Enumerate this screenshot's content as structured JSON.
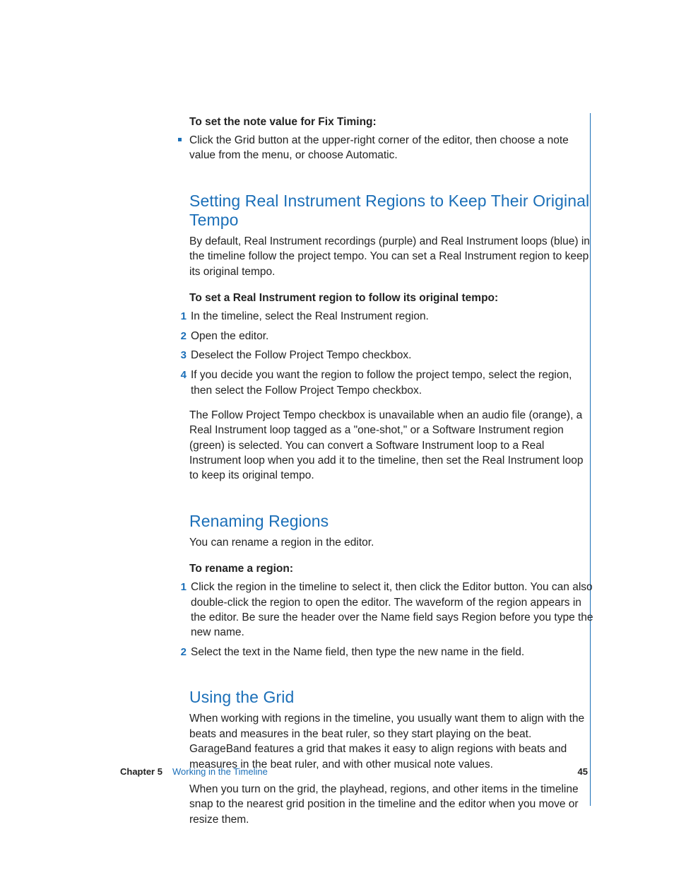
{
  "sec1": {
    "bold": "To set the note value for Fix Timing:",
    "bullet": "Click the Grid button at the upper-right corner of the editor, then choose a note value from the menu, or choose Automatic."
  },
  "sec2": {
    "heading": "Setting Real Instrument Regions to Keep Their Original Tempo",
    "intro": "By default, Real Instrument recordings (purple) and Real Instrument loops (blue) in the timeline follow the project tempo. You can set a Real Instrument region to keep its original tempo.",
    "bold": "To set a Real Instrument region to follow its original tempo:",
    "steps": [
      "In the timeline, select the Real Instrument region.",
      "Open the editor.",
      "Deselect the Follow Project Tempo checkbox.",
      "If you decide you want the region to follow the project tempo, select the region, then select the Follow Project Tempo checkbox."
    ],
    "note": "The Follow Project Tempo checkbox is unavailable when an audio file (orange), a Real Instrument loop tagged as a \"one-shot,\" or a Software Instrument region (green) is selected. You can convert a Software Instrument loop to a Real Instrument loop when you add it to the timeline, then set the Real Instrument loop to keep its original tempo."
  },
  "sec3": {
    "heading": "Renaming Regions",
    "intro": "You can rename a region in the editor.",
    "bold": "To rename a region:",
    "steps": [
      "Click the region in the timeline to select it, then click the Editor button. You can also double-click the region to open the editor. The waveform of the region appears in the editor. Be sure the header over the Name field says Region before you type the new name.",
      "Select the text in the Name field, then type the new name in the field."
    ]
  },
  "sec4": {
    "heading": "Using the Grid",
    "p1": "When working with regions in the timeline, you usually want them to align with the beats and measures in the beat ruler, so they start playing on the beat. GarageBand features a grid that makes it easy to align regions with beats and measures in the beat ruler, and with other musical note values.",
    "p2": "When you turn on the grid, the playhead, regions, and other items in the timeline snap to the nearest grid position in the timeline and the editor when you move or resize them."
  },
  "footer": {
    "chapter": "Chapter 5",
    "title": "Working in the Timeline",
    "page": "45"
  }
}
